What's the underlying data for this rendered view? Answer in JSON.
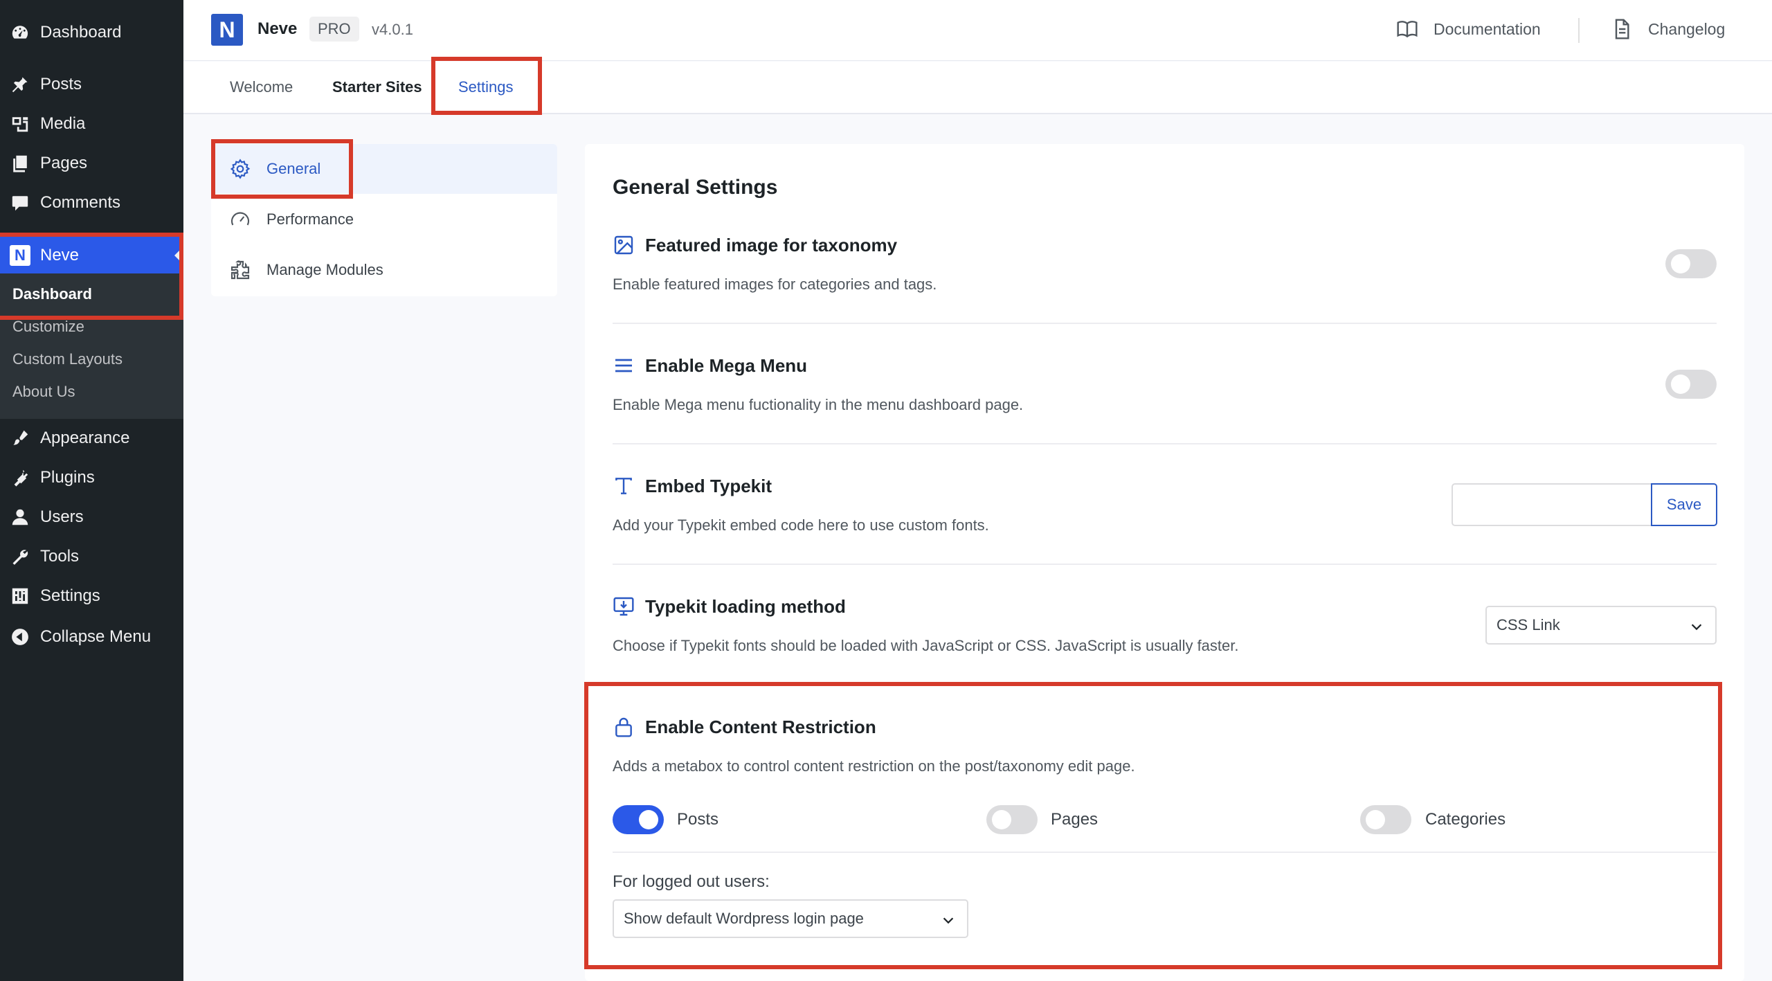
{
  "admin_menu": {
    "dashboard": "Dashboard",
    "posts": "Posts",
    "media": "Media",
    "pages": "Pages",
    "comments": "Comments",
    "neve": "Neve",
    "neve_sub": [
      "Dashboard",
      "Customize",
      "Custom Layouts",
      "About Us"
    ],
    "appearance": "Appearance",
    "plugins": "Plugins",
    "users": "Users",
    "tools": "Tools",
    "settings": "Settings",
    "collapse": "Collapse Menu"
  },
  "header": {
    "logo_letter": "N",
    "brand": "Neve",
    "badge": "PRO",
    "version": "v4.0.1",
    "documentation": "Documentation",
    "changelog": "Changelog"
  },
  "tabs": [
    "Welcome",
    "Starter Sites",
    "Settings"
  ],
  "settings_nav": [
    "General",
    "Performance",
    "Manage Modules"
  ],
  "panel": {
    "title": "General Settings",
    "options": [
      {
        "title": "Featured image for taxonomy",
        "desc": "Enable featured images for categories and tags.",
        "enabled": false
      },
      {
        "title": "Enable Mega Menu",
        "desc": "Enable Mega menu fuctionality in the menu dashboard page.",
        "enabled": false
      },
      {
        "title": "Embed Typekit",
        "desc": "Add your Typekit embed code here to use custom fonts.",
        "input_value": "",
        "button": "Save"
      },
      {
        "title": "Typekit loading method",
        "desc": "Choose if Typekit fonts should be loaded with JavaScript or CSS. JavaScript is usually faster.",
        "selected": "CSS Link"
      },
      {
        "title": "Enable Content Restriction",
        "desc": "Adds a metabox to control content restriction on the post/taxonomy edit page."
      }
    ],
    "restriction": {
      "posts": "Posts",
      "posts_on": true,
      "pages": "Pages",
      "pages_on": false,
      "categories": "Categories",
      "categories_on": false,
      "logged_out_label": "For logged out users:",
      "logged_out_selected": "Show default Wordpress login page"
    }
  },
  "colors": {
    "accent": "#2b59c3",
    "wp_admin_bg": "#1d2327",
    "neve_menu_active": "#2b59e8",
    "highlight": "#d63a2a"
  }
}
